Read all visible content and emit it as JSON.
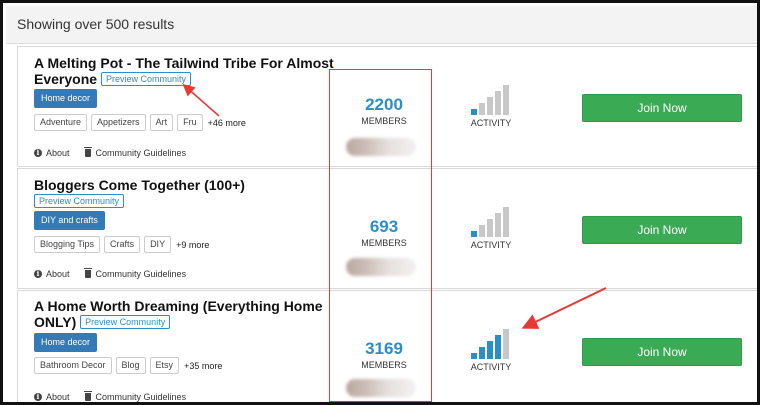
{
  "header": {
    "results_text": "Showing over 500 results"
  },
  "communities": [
    {
      "title": "A Melting Pot - The Tailwind Tribe For Almost Everyone",
      "preview_label": "Preview Community",
      "category": "Home decor",
      "tags": [
        "Adventure",
        "Appetizers",
        "Art",
        "Fru"
      ],
      "more": "+46 more",
      "about": "About",
      "guidelines": "Community Guidelines",
      "members": "2200",
      "members_label": "MEMBERS",
      "activity_label": "ACTIVITY",
      "activity_level": 0.2,
      "join_label": "Join Now"
    },
    {
      "title": "Bloggers Come Together (100+)",
      "preview_label": "Preview Community",
      "category": "DIY and crafts",
      "tags": [
        "Blogging Tips",
        "Crafts",
        "DIY"
      ],
      "more": "+9 more",
      "about": "About",
      "guidelines": "Community Guidelines",
      "members": "693",
      "members_label": "MEMBERS",
      "activity_label": "ACTIVITY",
      "activity_level": 0.2,
      "join_label": "Join Now"
    },
    {
      "title": "A Home Worth Dreaming (Everything Home ONLY)",
      "preview_label": "Preview Community",
      "category": "Home decor",
      "tags": [
        "Bathroom Decor",
        "Blog",
        "Etsy"
      ],
      "more": "+35 more",
      "about": "About",
      "guidelines": "Community Guidelines",
      "members": "3169",
      "members_label": "MEMBERS",
      "activity_label": "ACTIVITY",
      "activity_level": 0.8,
      "join_label": "Join Now"
    }
  ],
  "colors": {
    "accent_blue": "#2a8fc6",
    "category_blue": "#337ab7",
    "join_green": "#3aaa55",
    "annotation_red": "#e53935",
    "bar_active": "#2a8fc6",
    "bar_inactive": "#c8c8c8"
  }
}
